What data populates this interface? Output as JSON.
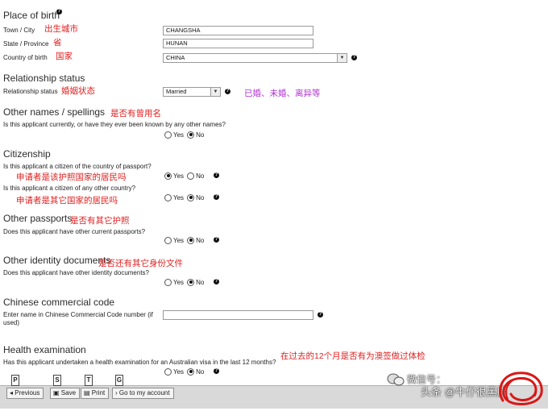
{
  "place_of_birth": {
    "heading": "Place of birth",
    "town_label": "Town / City",
    "town_note": "出生城市",
    "town_value": "CHANGSHA",
    "state_label": "State / Province",
    "state_note": "省",
    "state_value": "HUNAN",
    "country_label": "Country of birth",
    "country_note": "国家",
    "country_value": "CHINA"
  },
  "relationship": {
    "heading": "Relationship status",
    "label": "Relationship status",
    "note": "婚姻状态",
    "value": "Married",
    "side_note": "已婚、未婚、离异等"
  },
  "other_names": {
    "heading": "Other names / spellings",
    "note": "是否有曾用名",
    "question": "Is this applicant currently, or have they ever been known by any other names?",
    "yes": "Yes",
    "no": "No",
    "selected": "No"
  },
  "citizenship": {
    "heading": "Citizenship",
    "q1": "Is this applicant a citizen of the country of passport?",
    "q1_note": "申请者是该护照国家的居民吗",
    "q1_yes": "Yes",
    "q1_no": "No",
    "q1_selected": "Yes",
    "q2": "Is this applicant a citizen of any other country?",
    "q2_note": "申请者是其它国家的居民吗",
    "q2_yes": "Yes",
    "q2_no": "No",
    "q2_selected": "No"
  },
  "other_passports": {
    "heading": "Other passports",
    "note": "是否有其它护照",
    "question": "Does this applicant have other current passports?",
    "yes": "Yes",
    "no": "No",
    "selected": "No"
  },
  "other_identity": {
    "heading": "Other identity documents",
    "note": "是否还有其它身份文件",
    "question": "Does this applicant have other identity documents?",
    "yes": "Yes",
    "no": "No",
    "selected": "No"
  },
  "commercial_code": {
    "heading": "Chinese commercial code",
    "label_line1": "Enter name in Chinese Commercial Code number (if",
    "label_line2": "used)",
    "value": ""
  },
  "health": {
    "heading": "Health examination",
    "question": "Has this applicant undertaken a health examination for an Australian visa in the last 12 months?",
    "note": "在过去的12个月是否有为澳签做过体检",
    "yes": "Yes",
    "no": "No",
    "selected": "No"
  },
  "toolbar": {
    "previous": "Previous",
    "save": "Save",
    "print": "Print",
    "goto": "Go to my account",
    "key_p": "P",
    "key_s": "S",
    "key_t": "T",
    "key_g": "G"
  },
  "watermark": {
    "text1": "微信号：",
    "text2": "头条 @牛仔很黑胖"
  },
  "help_glyph": "?"
}
